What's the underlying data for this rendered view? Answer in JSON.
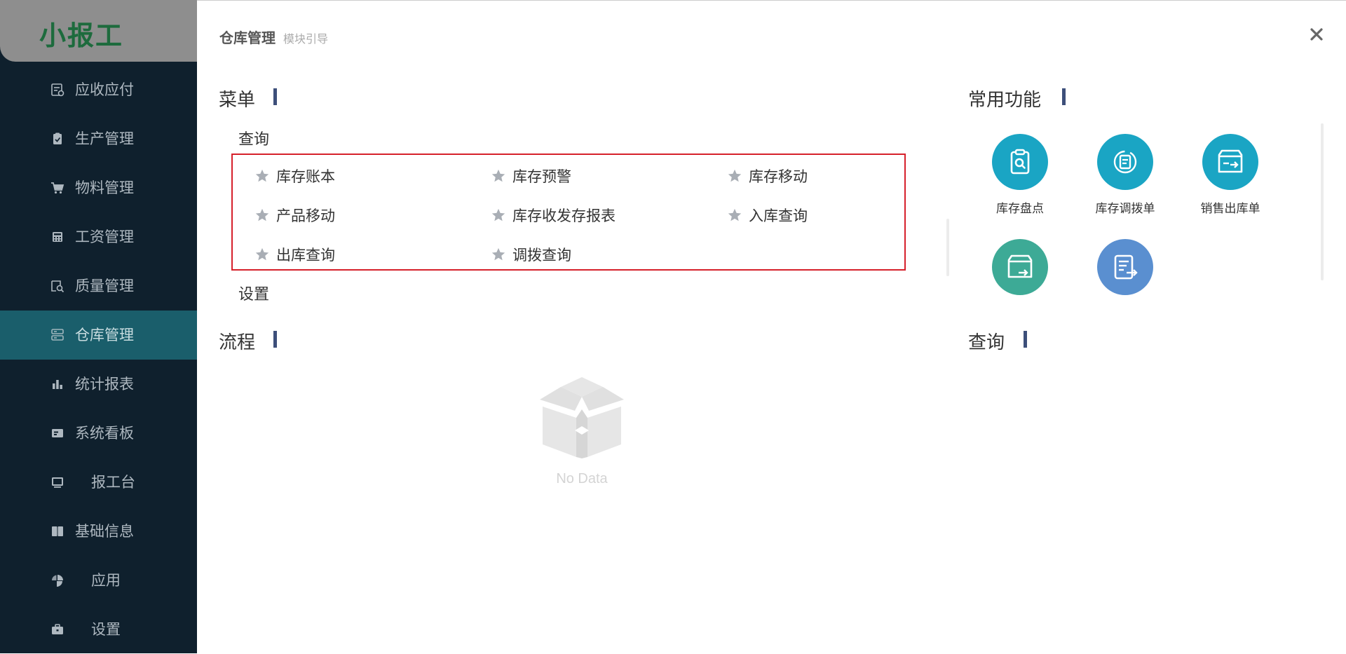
{
  "logo": "小报工",
  "sidebar": {
    "items": [
      {
        "label": "应收应付",
        "icon": "receivable-icon"
      },
      {
        "label": "生产管理",
        "icon": "clipboard-check-icon"
      },
      {
        "label": "物料管理",
        "icon": "cart-icon"
      },
      {
        "label": "工资管理",
        "icon": "calculator-icon"
      },
      {
        "label": "质量管理",
        "icon": "inspection-icon"
      },
      {
        "label": "仓库管理",
        "icon": "warehouse-icon",
        "active": true
      },
      {
        "label": "统计报表",
        "icon": "bar-chart-icon"
      },
      {
        "label": "系统看板",
        "icon": "dashboard-card-icon"
      },
      {
        "label": "报工台",
        "icon": "monitor-icon"
      },
      {
        "label": "基础信息",
        "icon": "book-icon"
      },
      {
        "label": "应用",
        "icon": "apps-icon"
      },
      {
        "label": "设置",
        "icon": "toolbox-icon"
      }
    ]
  },
  "header": {
    "title": "仓库管理",
    "subtitle": "模块引导"
  },
  "menu_section": {
    "title": "菜单",
    "query_group": "查询",
    "items": [
      "库存账本",
      "库存预警",
      "库存移动",
      "产品移动",
      "库存收发存报表",
      "入库查询",
      "出库查询",
      "调拨查询"
    ],
    "settings_group": "设置"
  },
  "flow_section": {
    "title": "流程",
    "empty_text": "No Data"
  },
  "common_section": {
    "title": "常用功能",
    "items": [
      {
        "label": "库存盘点",
        "icon": "inventory-check-icon",
        "color": "#1aa5c4"
      },
      {
        "label": "库存调拨单",
        "icon": "transfer-order-icon",
        "color": "#1aa5c4"
      },
      {
        "label": "销售出库单",
        "icon": "sales-outbound-icon",
        "color": "#1aa5c4"
      },
      {
        "label": "",
        "icon": "box-outbound-icon",
        "color": "#3daa96"
      },
      {
        "label": "",
        "icon": "document-export-icon",
        "color": "#5a8fd0"
      }
    ]
  },
  "query_section": {
    "title": "查询"
  },
  "colors": {
    "sidebar_bg": "#0f202d",
    "sidebar_active": "#1a5e6b",
    "highlight_border": "#d6202b",
    "section_bar": "#3d4f7a"
  }
}
